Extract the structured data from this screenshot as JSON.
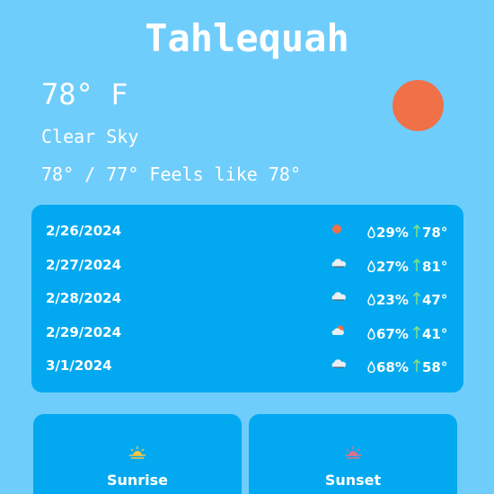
{
  "location": {
    "city": "Tahlequah"
  },
  "current": {
    "temperature": "78° F",
    "condition": "Clear Sky",
    "high_low_feels": "78° / 77° Feels like 78°",
    "icon": "sun-icon",
    "icon_color": "#f07048"
  },
  "forecast": [
    {
      "date": "2/26/2024",
      "icon": "sun-icon",
      "humidity": "29%",
      "high": "78°"
    },
    {
      "date": "2/27/2024",
      "icon": "cloud-icon",
      "humidity": "27%",
      "high": "81°"
    },
    {
      "date": "2/28/2024",
      "icon": "cloud-icon",
      "humidity": "23%",
      "high": "47°"
    },
    {
      "date": "2/29/2024",
      "icon": "partly-cloudy-icon",
      "humidity": "67%",
      "high": "41°"
    },
    {
      "date": "3/1/2024",
      "icon": "cloud-icon",
      "humidity": "68%",
      "high": "58°"
    }
  ],
  "sun_times": {
    "sunrise_label": "Sunrise",
    "sunset_label": "Sunset"
  },
  "colors": {
    "background": "#6fcdfb",
    "panel": "#02a9f0",
    "accent_sun": "#f07048",
    "arrow_up": "#7ee08a",
    "sunrise_icon": "#f4c542",
    "sunset_icon": "#e0708a"
  }
}
